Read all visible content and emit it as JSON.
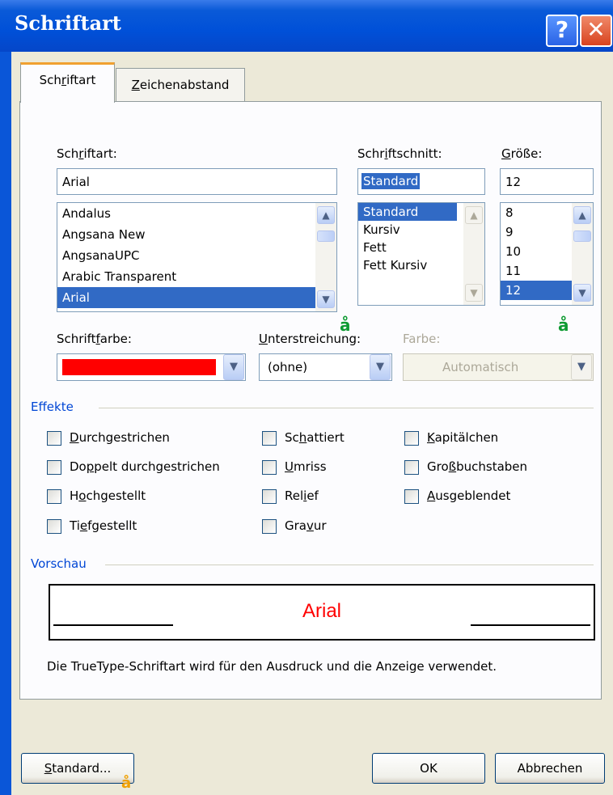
{
  "window": {
    "title": "Schriftart",
    "help_glyph": "?",
    "close_glyph": "✕"
  },
  "tabs": [
    {
      "pre": "Sch",
      "ul": "r",
      "post": "iftart"
    },
    {
      "pre": "",
      "ul": "Z",
      "post": "eichenabstand"
    }
  ],
  "font": {
    "label_pre": "Sch",
    "label_ul": "r",
    "label_post": "iftart:",
    "value": "Arial",
    "items": [
      "Andalus",
      "Angsana New",
      "AngsanaUPC",
      "Arabic Transparent",
      "Arial"
    ],
    "selected": "Arial"
  },
  "style": {
    "label_pre": "Schr",
    "label_ul": "i",
    "label_post": "ftschnitt:",
    "value": "Standard",
    "items": [
      "Standard",
      "Kursiv",
      "Fett",
      "Fett Kursiv"
    ],
    "selected": "Standard"
  },
  "size": {
    "label_pre": "",
    "label_ul": "G",
    "label_post": "röße:",
    "value": "12",
    "items": [
      "8",
      "9",
      "10",
      "11",
      "12"
    ],
    "selected": "12"
  },
  "font_color": {
    "label_pre": "Schrift",
    "label_ul": "f",
    "label_post": "arbe:",
    "color": "#ff0000"
  },
  "underline": {
    "label_pre": "",
    "label_ul": "U",
    "label_post": "nterstreichung:",
    "value": "(ohne)"
  },
  "underline_color": {
    "label": "Farbe:",
    "value": "Automatisch"
  },
  "effects": {
    "title": "Effekte",
    "items": [
      {
        "pre": "",
        "ul": "D",
        "post": "urchgestrichen"
      },
      {
        "pre": "Do",
        "ul": "p",
        "post": "pelt durchgestrichen"
      },
      {
        "pre": "H",
        "ul": "o",
        "post": "chgestellt"
      },
      {
        "pre": "Ti",
        "ul": "e",
        "post": "fgestellt"
      },
      {
        "pre": "Sc",
        "ul": "h",
        "post": "attiert"
      },
      {
        "pre": "",
        "ul": "U",
        "post": "mriss"
      },
      {
        "pre": "Rel",
        "ul": "i",
        "post": "ef"
      },
      {
        "pre": "Gra",
        "ul": "v",
        "post": "ur"
      },
      {
        "pre": "",
        "ul": "K",
        "post": "apitälchen"
      },
      {
        "pre": "Gro",
        "ul": "ß",
        "post": "buchstaben"
      },
      {
        "pre": "",
        "ul": "A",
        "post": "usgeblendet"
      }
    ]
  },
  "preview": {
    "title": "Vorschau",
    "sample": "Arial",
    "sample_color": "#ff0000",
    "description": "Die TrueType-Schriftart wird für den Ausdruck und die Anzeige verwendet."
  },
  "buttons": {
    "default_pre": "",
    "default_ul": "S",
    "default_post": "tandard...",
    "ok": "OK",
    "cancel": "Abbrechen"
  },
  "marks": {
    "glyph": "å"
  },
  "scroll_glyphs": {
    "up": "▲",
    "down": "▼",
    "drop": "▼"
  }
}
